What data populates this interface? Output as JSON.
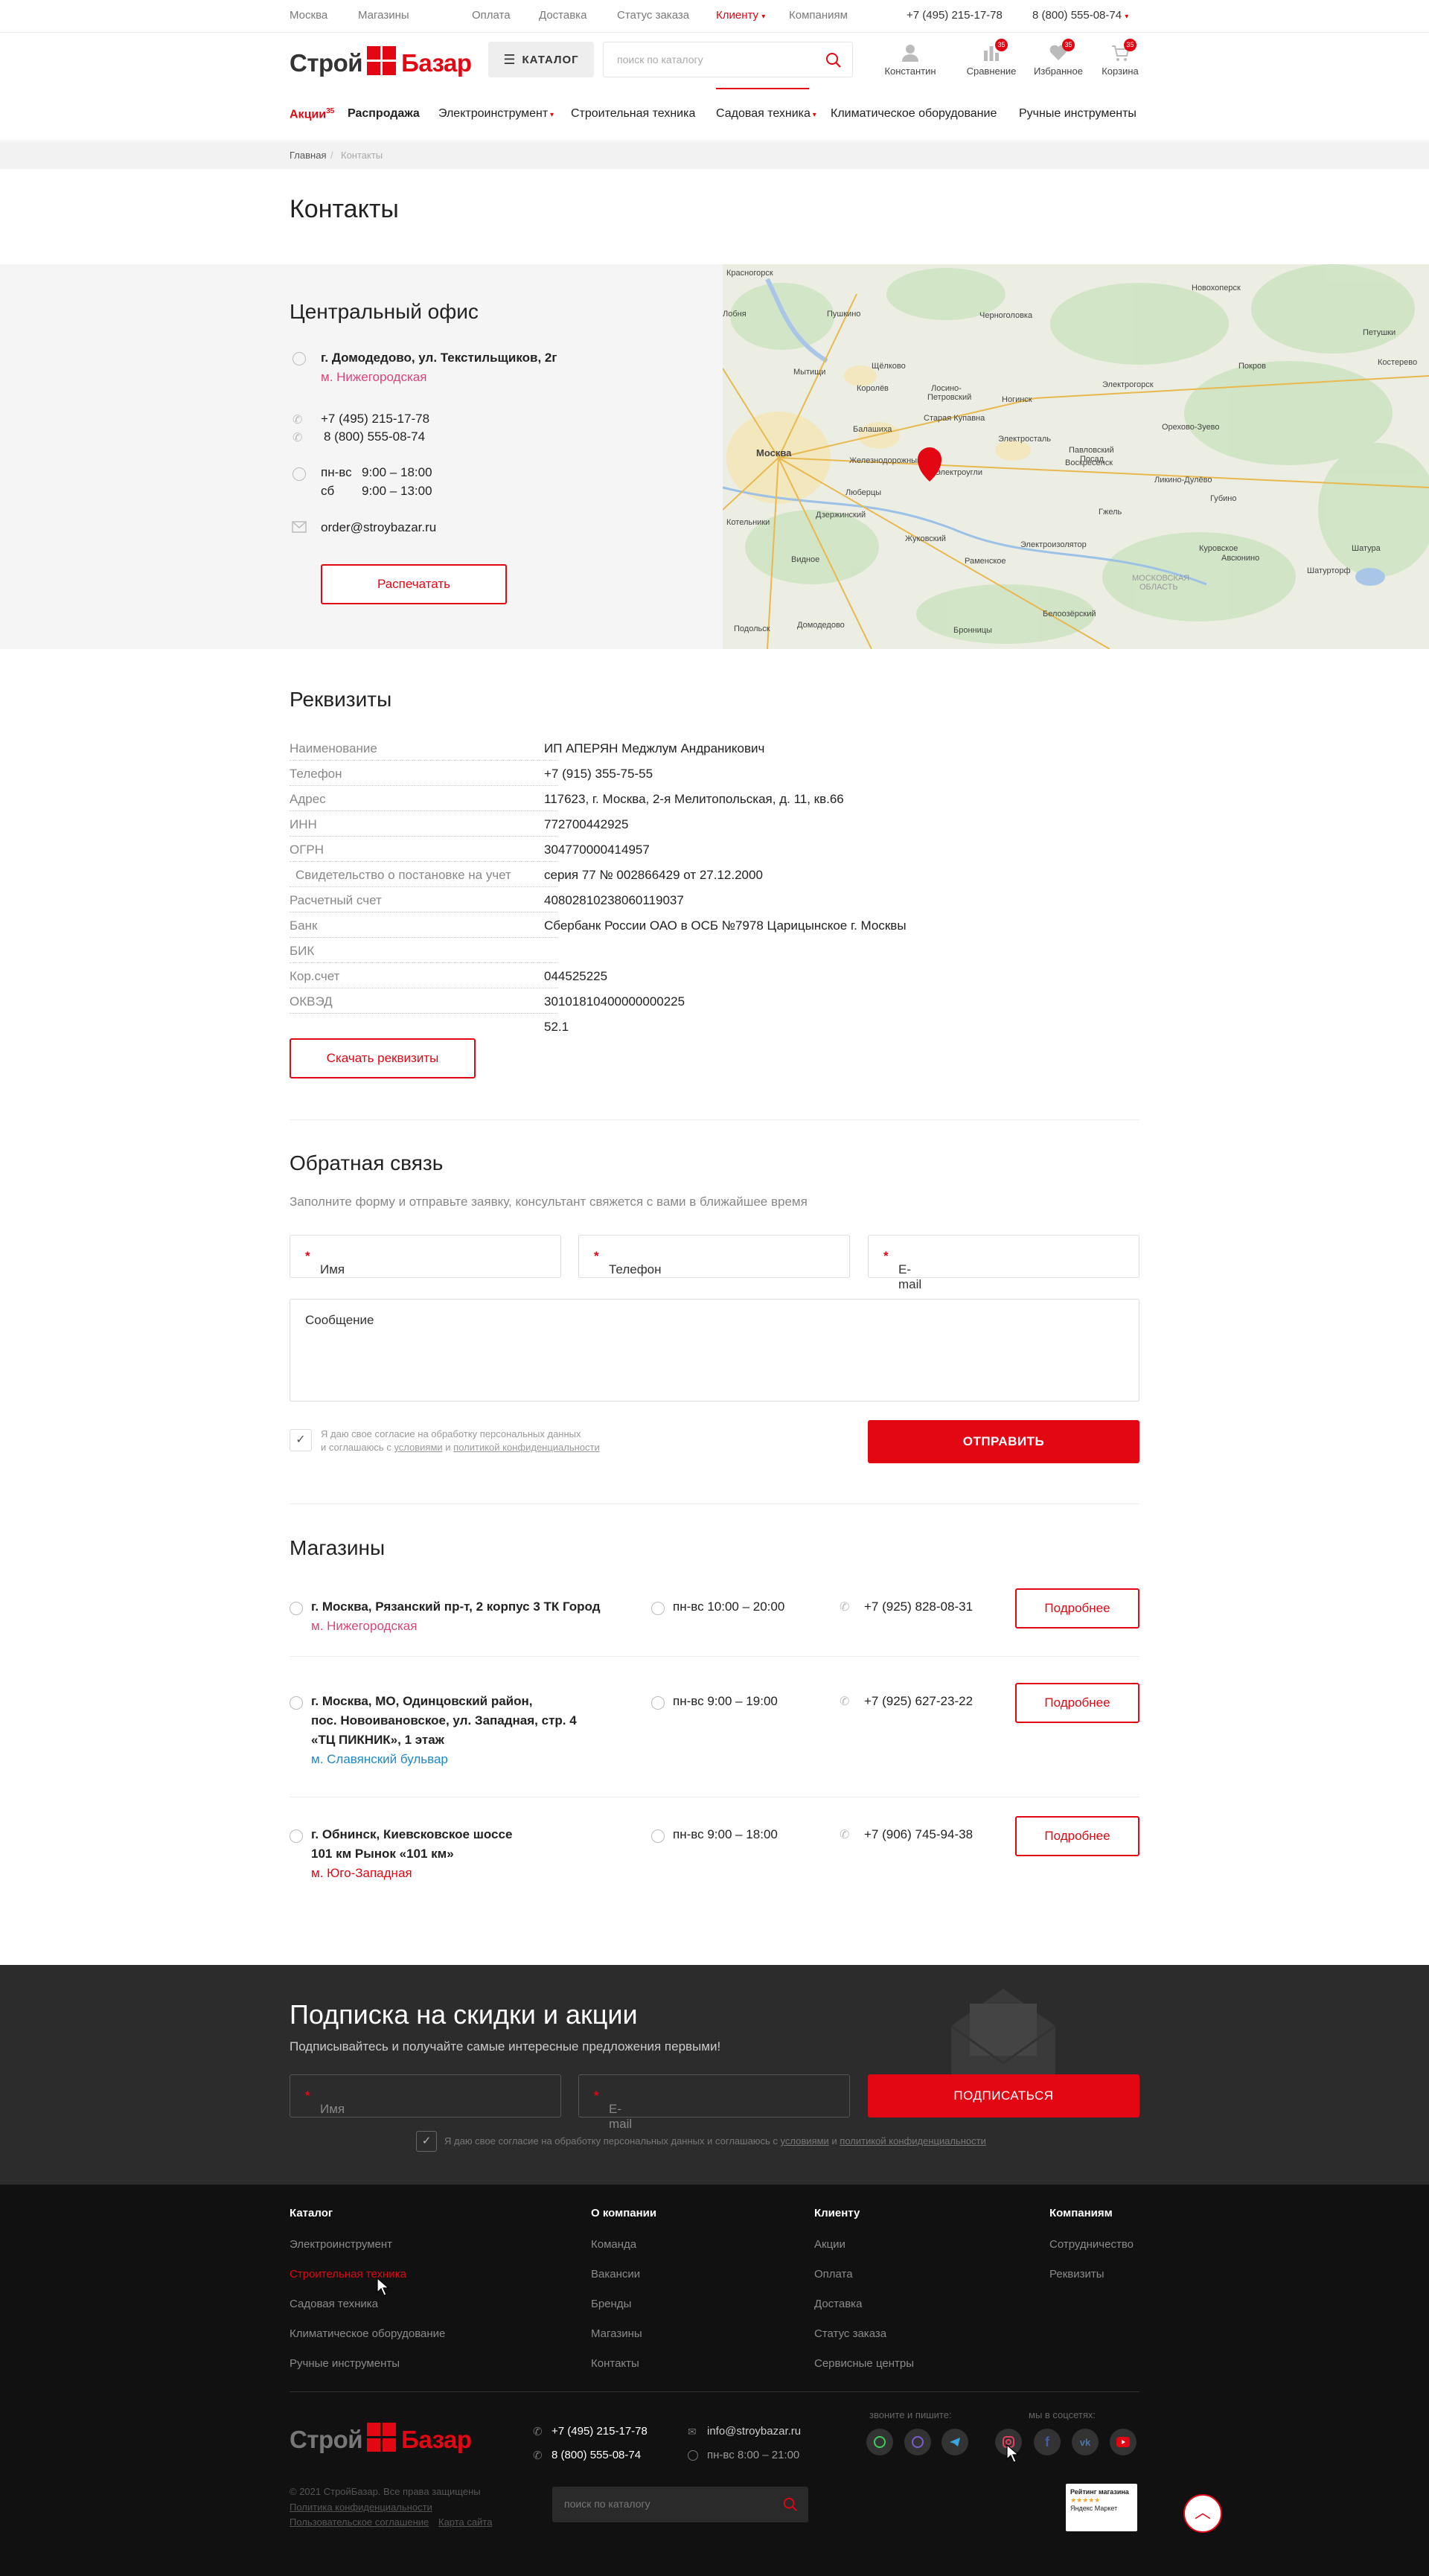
{
  "topbar": {
    "city": "Москва",
    "links": [
      "Магазины",
      "Оплата",
      "Доставка",
      "Статус заказа",
      "Клиенту",
      "Компаниям"
    ],
    "phone1": "+7 (495) 215-17-78",
    "phone2": "8 (800) 555-08-74"
  },
  "header": {
    "logo_left": "Строй",
    "logo_right": "Базар",
    "catalog_label": "КАТАЛОГ",
    "search_placeholder": "поиск по каталогу",
    "user_label": "Константин",
    "compare_label": "Сравнение",
    "compare_count": "35",
    "favorites_label": "Избранное",
    "favorites_count": "35",
    "cart_label": "Корзина",
    "cart_count": "35"
  },
  "nav": {
    "items": [
      "Акции",
      "Распродажа",
      "Электроинструмент",
      "Строительная техника",
      "Садовая техника",
      "Климатическое оборудование",
      "Ручные инструменты"
    ],
    "sale_count": "35"
  },
  "breadcrumb": {
    "home": "Главная",
    "sep": "/",
    "current": "Контакты"
  },
  "page_title": "Контакты",
  "office": {
    "title": "Центральный офис",
    "address": "г. Домодедово, ул. Текстильщиков, 2г",
    "metro": "м. Нижегородская",
    "phone1": "+7 (495) 215-17-78",
    "phone2": "8 (800) 555-08-74",
    "hours1_days": "пн-вс",
    "hours1_time": "9:00 – 18:00",
    "hours2_days": "сб",
    "hours2_time": "9:00 – 13:00",
    "email": "order@stroybazar.ru",
    "print_button": "Распечатать"
  },
  "map": {
    "labels": [
      "Красногорск",
      "Лобня",
      "Пушкино",
      "Черноголовка",
      "Мытищи",
      "Щёлково",
      "Королёв",
      "Лосино-Петровский",
      "Ногинск",
      "Балашиха",
      "Старая Купавна",
      "Электрогорск",
      "Москва",
      "Железнодорожный",
      "Электросталь",
      "Электроугли",
      "Орехово-Зуево",
      "Павловский Посад",
      "Люберцы",
      "Ликино-Дулёво",
      "Жуковский",
      "Куровское",
      "Видное",
      "Раменское",
      "Домодедово",
      "Бронницы",
      "Подольск",
      "Белоозёрский",
      "Новохоперск",
      "Покров",
      "Костерево",
      "Петушки",
      "Шатурторф",
      "Шатура",
      "Авсюнино",
      "Московская область",
      "Воскресенск",
      "Гжель",
      "Электроизолятор",
      "Дзержинский",
      "Котельники"
    ]
  },
  "requisites": {
    "title": "Реквизиты",
    "labels": [
      "Наименование",
      "Телефон",
      "Адрес",
      "ИНН",
      "ОГРН",
      "Свидетельство о постановке на учет",
      "Расчетный счет",
      "Банк",
      "БИК",
      "Кор.счет",
      "ОКВЭД"
    ],
    "values": [
      "ИП АПЕРЯН Меджлум Андраникович",
      "+7 (915) 355-75-55",
      "117623, г. Москва, 2-я Мелитопольская, д. 11, кв.66",
      "772700442925",
      "304770000414957",
      "серия 77 № 002866429 от 27.12.2000",
      "40802810238060119037",
      "Сбербанк России ОАО в ОСБ №7978 Царицынское г. Москвы",
      "",
      "044525225",
      "30101810400000000225",
      "52.1"
    ],
    "download_button": "Скачать реквизиты"
  },
  "feedback": {
    "title": "Обратная связь",
    "subtitle": "Заполните форму и отправьте заявку, консультант свяжется с вами в ближайшее время",
    "name_placeholder": "Имя",
    "phone_placeholder": "Телефон",
    "email_placeholder": "E-mail",
    "required_mark": "*",
    "message_placeholder": "Сообщение",
    "consent_line1": "Я даю свое согласие на обработку персональных данных",
    "consent_line2_pre": "и соглашаюсь с ",
    "consent_terms": "условиями",
    "consent_and": " и ",
    "consent_policy": "политикой конфиденциальности",
    "submit": "ОТПРАВИТЬ"
  },
  "shops": {
    "title": "Магазины",
    "more": "Подробнее",
    "list": [
      {
        "addr1": "г. Москва, Рязанский пр-т, 2 корпус 3 ТК Город",
        "addr2": "",
        "addr3": "",
        "metro": "м. Нижегородская",
        "metro_color": "#d9457a",
        "hours": "пн-вс 10:00 – 20:00",
        "phone": "+7 (925) 828-08-31"
      },
      {
        "addr1": "г. Москва, МО, Одинцовский район,",
        "addr2": "пос. Новоивановское, ул. Западная, стр. 4",
        "addr3": "«ТЦ ПИКНИК», 1 этаж",
        "metro": "м. Славянский бульвар",
        "metro_color": "#1e88c7",
        "hours": "пн-вс 9:00 – 19:00",
        "phone": "+7 (925) 627-23-22"
      },
      {
        "addr1": "г. Обнинск, Киевсковское шоссе",
        "addr2": "101 км Рынок «101 км»",
        "addr3": "",
        "metro": "м. Юго-Западная",
        "metro_color": "#e30613",
        "hours": "пн-вс 9:00 – 18:00",
        "phone": "+7 (906) 745-94-38"
      }
    ]
  },
  "subscribe": {
    "title": "Подписка на скидки и акции",
    "subtitle": "Подписывайтесь и получайте самые интересные предложения первыми!",
    "name_placeholder": "Имя",
    "email_placeholder": "E-mail",
    "button": "ПОДПИСАТЬСЯ",
    "consent_pre": "Я даю свое согласие на обработку персональных данных и соглашаюсь с ",
    "consent_terms": "условиями",
    "consent_and": " и ",
    "consent_policy": "политикой конфиденциальности"
  },
  "footer": {
    "col1_title": "Каталог",
    "col1": [
      "Электроинструмент",
      "Строительная техника",
      "Садовая техника",
      "Климатическое оборудование",
      "Ручные инструменты"
    ],
    "col2_title": "О компании",
    "col2": [
      "Команда",
      "Вакансии",
      "Бренды",
      "Магазины",
      "Контакты"
    ],
    "col3_title": "Клиенту",
    "col3": [
      "Акции",
      "Оплата",
      "Доставка",
      "Статус заказа",
      "Сервисные центры"
    ],
    "col4_title": "Компаниям",
    "col4": [
      "Сотрудничество",
      "Реквизиты"
    ],
    "phone1": "+7 (495) 215-17-78",
    "phone2": "8 (800) 555-08-74",
    "email": "info@stroybazar.ru",
    "hours": "пн-вс 8:00 – 21:00",
    "call_label": "звоните и пишите:",
    "social_label": "мы в соцсетях:",
    "copyright": "© 2021 СтройБазар. Все права защищены",
    "privacy": "Политика конфиденциальности",
    "agreement": "Пользовательское соглашение",
    "sitemap": "Карта сайта",
    "search_placeholder": "поиск по каталогу",
    "rating_title": "Рейтинг магазина",
    "rating_stars": "★★★★★",
    "rating_source": "Яндекс Маркет"
  },
  "colors": {
    "accent": "#e30613",
    "footer_bg": "#111111",
    "subscribe_bg": "#2c2c2c"
  }
}
